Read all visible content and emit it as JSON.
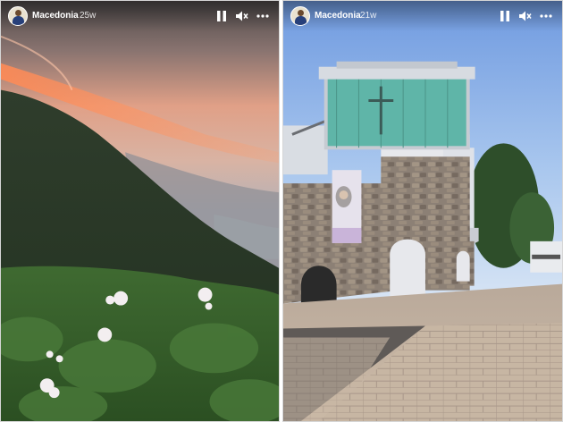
{
  "stories": [
    {
      "account_name": "Macedonia",
      "posted_ago": "25w",
      "controls": {
        "pause_icon": "pause-icon",
        "mute_icon": "speaker-muted-icon",
        "more_icon": "more-horizontal-icon"
      },
      "scene": "mountain-sunset-wildflowers"
    },
    {
      "account_name": "Macedonia",
      "posted_ago": "21w",
      "controls": {
        "pause_icon": "pause-icon",
        "mute_icon": "speaker-muted-icon",
        "more_icon": "more-horizontal-icon"
      },
      "scene": "stone-memorial-house-plaza"
    }
  ],
  "colors": {
    "overlay_text": "#ffffff",
    "sunset": "#e98a5b",
    "sky": "#a9c7ee"
  }
}
